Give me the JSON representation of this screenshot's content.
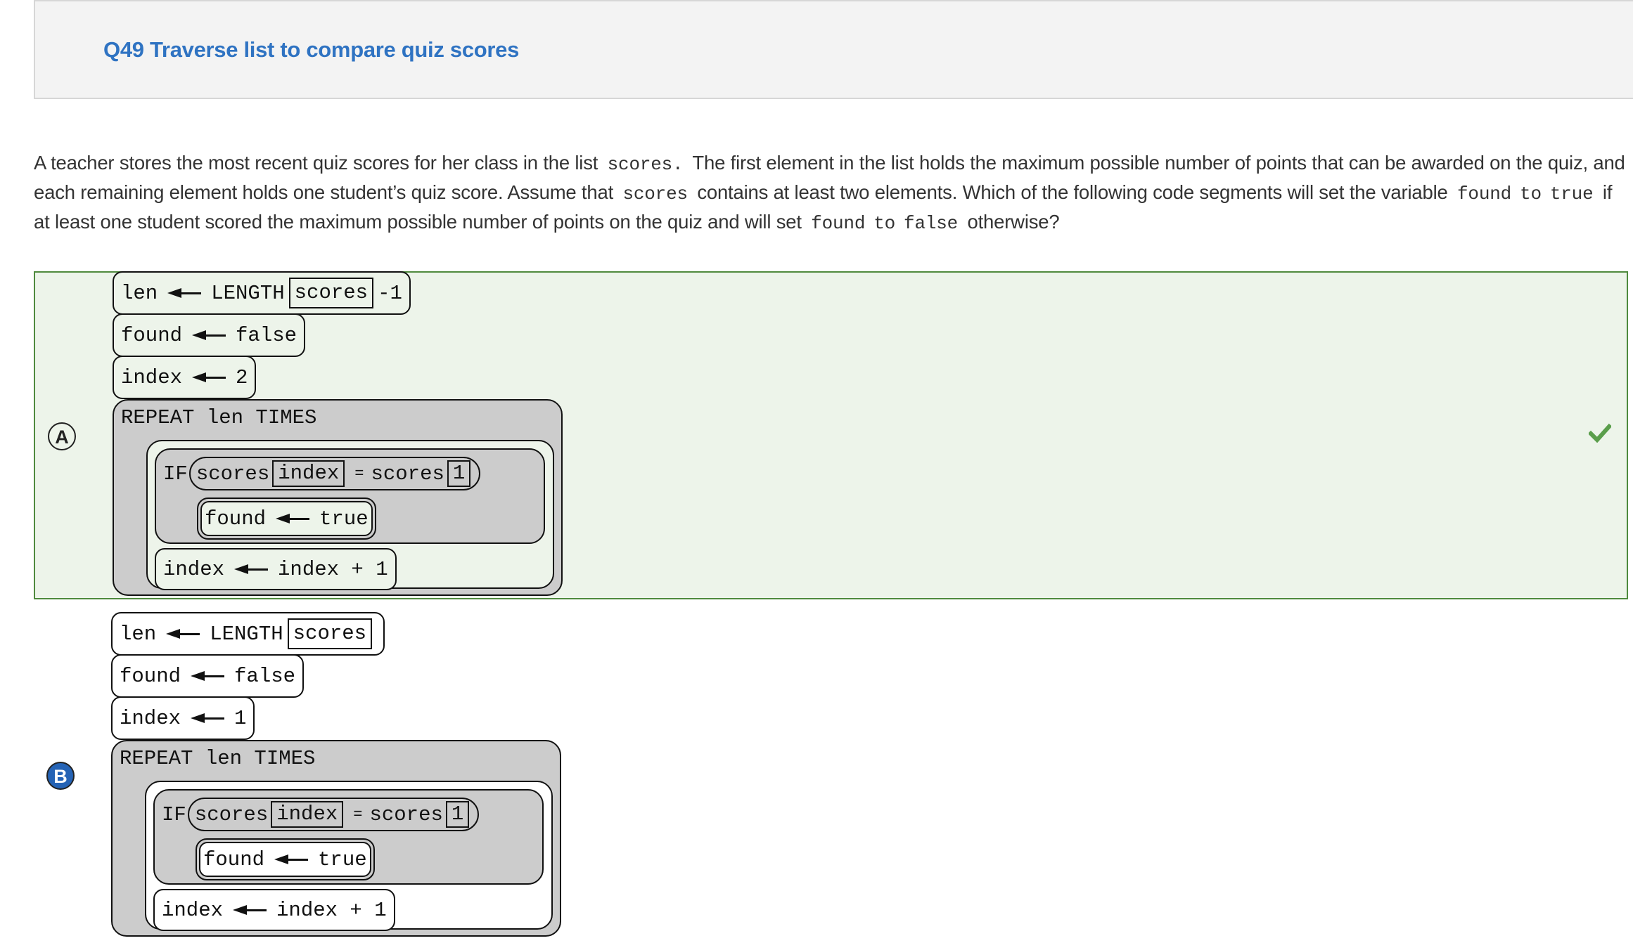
{
  "header": {
    "title": "Q49 Traverse list to compare quiz scores"
  },
  "question": {
    "segments": [
      {
        "text": "A teacher stores the most recent quiz scores for her class in the list "
      },
      {
        "code": "scores."
      },
      {
        "text": " The first element in the list holds the maximum possible number of points that can be awarded on the quiz, and each remaining element holds one student’s quiz score. Assume that "
      },
      {
        "code": "scores"
      },
      {
        "text": " contains at least two elements. Which of the following code segments will set the variable "
      },
      {
        "code": "found"
      },
      {
        "code": "to"
      },
      {
        "code": "true"
      },
      {
        "text": " if at least one student scored the maximum possible number of points on the quiz and will set "
      },
      {
        "code": "found"
      },
      {
        "code": "to"
      },
      {
        "code": "false"
      },
      {
        "text": " otherwise?"
      }
    ]
  },
  "options": [
    {
      "letter": "A",
      "state": "correct",
      "selected": false,
      "status_icon": "checkmark-icon",
      "status_color": "#5a9e4b",
      "code": {
        "len_var": "len",
        "len_expr_kw": "LENGTH",
        "len_expr_arg": "scores",
        "len_expr_suffix": "-1",
        "found_var": "found",
        "found_init": "false",
        "index_var": "index",
        "index_init": "2",
        "repeat_header": "REPEAT len TIMES",
        "if_kw": "IF",
        "cond_left_list": "scores",
        "cond_left_index": "index",
        "cond_op": "=",
        "cond_right_list": "scores",
        "cond_right_index": "1",
        "then_var": "found",
        "then_val": "true",
        "inc_var": "index",
        "inc_expr": "index + 1"
      }
    },
    {
      "letter": "B",
      "state": "selected",
      "selected": true,
      "code": {
        "len_var": "len",
        "len_expr_kw": "LENGTH",
        "len_expr_arg": "scores",
        "len_expr_suffix": "",
        "found_var": "found",
        "found_init": "false",
        "index_var": "index",
        "index_init": "1",
        "repeat_header": "REPEAT len TIMES",
        "if_kw": "IF",
        "cond_left_list": "scores",
        "cond_left_index": "index",
        "cond_op": "=",
        "cond_right_list": "scores",
        "cond_right_index": "1",
        "then_var": "found",
        "then_val": "true",
        "inc_var": "index",
        "inc_expr": "index + 1"
      }
    }
  ],
  "colors": {
    "title_blue": "#2f73c2",
    "correct_bg": "#edf4ea",
    "correct_border": "#4f8a3e",
    "selected_letter_bg": "#2563b5",
    "block_gray": "#cccccc"
  }
}
